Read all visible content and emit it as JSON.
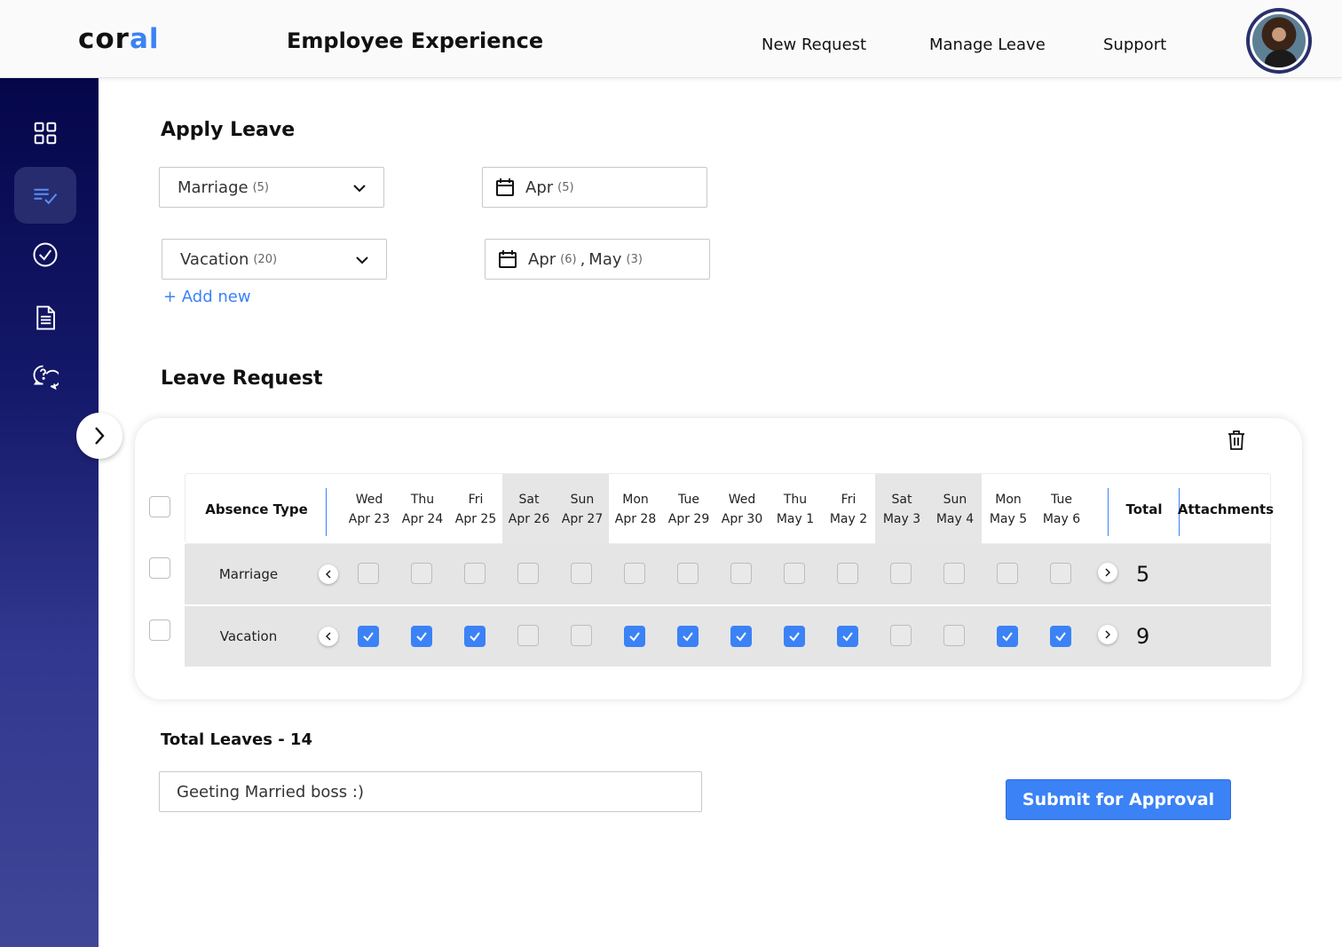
{
  "header": {
    "logo_prefix": "cor",
    "logo_accent": "al",
    "title": "Employee Experience",
    "nav": [
      "New Request",
      "Manage Leave",
      "Support"
    ],
    "avatar_icon": "user-avatar"
  },
  "sidebar": {
    "items": [
      {
        "icon": "dashboard-grid-icon",
        "active": false
      },
      {
        "icon": "list-check-icon",
        "active": true
      },
      {
        "icon": "check-circle-icon",
        "active": false
      },
      {
        "icon": "document-icon",
        "active": false
      },
      {
        "icon": "chat-help-icon",
        "active": false
      }
    ],
    "expand_icon": "chevron-right-icon"
  },
  "apply_leave": {
    "title": "Apply Leave",
    "types": [
      {
        "label": "Marriage",
        "count": "(5)"
      },
      {
        "label": "Vacation",
        "count": "(20)"
      }
    ],
    "dates": [
      {
        "m1": "Apr",
        "c1": "(5)",
        "sep": "",
        "m2": "",
        "c2": ""
      },
      {
        "m1": "Apr",
        "c1": "(6)",
        "sep": ",",
        "m2": "May",
        "c2": "(3)"
      }
    ],
    "add_new": "+ Add new"
  },
  "leave_request": {
    "title": "Leave Request",
    "columns": {
      "absence_type": "Absence Type",
      "total": "Total",
      "attachments": "Attachments"
    },
    "days": [
      {
        "dow": "Wed",
        "date": "Apr 23",
        "weekend": false
      },
      {
        "dow": "Thu",
        "date": "Apr 24",
        "weekend": false
      },
      {
        "dow": "Fri",
        "date": "Apr 25",
        "weekend": false
      },
      {
        "dow": "Sat",
        "date": "Apr 26",
        "weekend": true
      },
      {
        "dow": "Sun",
        "date": "Apr 27",
        "weekend": true
      },
      {
        "dow": "Mon",
        "date": "Apr 28",
        "weekend": false
      },
      {
        "dow": "Tue",
        "date": "Apr 29",
        "weekend": false
      },
      {
        "dow": "Wed",
        "date": "Apr 30",
        "weekend": false
      },
      {
        "dow": "Thu",
        "date": "May 1",
        "weekend": false
      },
      {
        "dow": "Fri",
        "date": "May 2",
        "weekend": false
      },
      {
        "dow": "Sat",
        "date": "May 3",
        "weekend": true
      },
      {
        "dow": "Sun",
        "date": "May 4",
        "weekend": true
      },
      {
        "dow": "Mon",
        "date": "May 5",
        "weekend": false
      },
      {
        "dow": "Tue",
        "date": "May 6",
        "weekend": false
      }
    ],
    "rows": [
      {
        "type": "Marriage",
        "checks": [
          false,
          false,
          false,
          false,
          false,
          false,
          false,
          false,
          false,
          false,
          false,
          false,
          false,
          false
        ],
        "total": "5"
      },
      {
        "type": "Vacation",
        "checks": [
          true,
          true,
          true,
          false,
          false,
          true,
          true,
          true,
          true,
          true,
          false,
          false,
          true,
          true
        ],
        "total": "9"
      }
    ]
  },
  "total_leaves": "Total Leaves - 14",
  "reason": {
    "value": "Geeting Married boss :)"
  },
  "submit_label": "Submit for Approval",
  "colors": {
    "accent": "#3b82f6",
    "sidebar_top": "#05064a",
    "sidebar_bottom": "#3f4697"
  }
}
